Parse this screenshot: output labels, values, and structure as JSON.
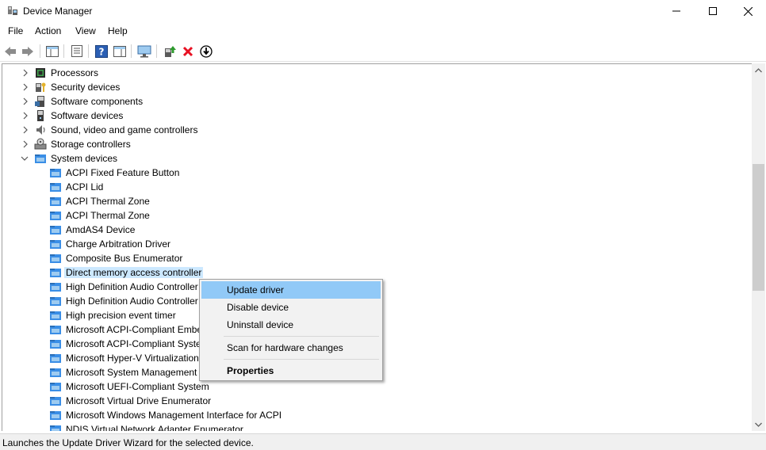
{
  "window": {
    "title": "Device Manager",
    "icon": "device-manager-icon"
  },
  "menu": [
    "File",
    "Action",
    "View",
    "Help"
  ],
  "toolbar": {
    "buttons": [
      "back-arrow-icon",
      "forward-arrow-icon",
      "show-hide-console-tree-icon",
      "properties-icon",
      "help-icon",
      "action-pane-icon",
      "monitor-icon",
      "update-driver-icon",
      "uninstall-icon",
      "download-icon"
    ]
  },
  "tree": {
    "categories": [
      {
        "label": "Processors",
        "icon": "processor-icon",
        "expanded": false
      },
      {
        "label": "Security devices",
        "icon": "security-icon",
        "expanded": false
      },
      {
        "label": "Software components",
        "icon": "software-component-icon",
        "expanded": false
      },
      {
        "label": "Software devices",
        "icon": "software-device-icon",
        "expanded": false
      },
      {
        "label": "Sound, video and game controllers",
        "icon": "speaker-icon",
        "expanded": false
      },
      {
        "label": "Storage controllers",
        "icon": "storage-icon",
        "expanded": false
      },
      {
        "label": "System devices",
        "icon": "system-folder-icon",
        "expanded": true
      }
    ],
    "system_devices": [
      "ACPI Fixed Feature Button",
      "ACPI Lid",
      "ACPI Thermal Zone",
      "ACPI Thermal Zone",
      "AmdAS4 Device",
      "Charge Arbitration Driver",
      "Composite Bus Enumerator",
      "Direct memory access controller",
      "High Definition Audio Controller",
      "High Definition Audio Controller",
      "High precision event timer",
      "Microsoft ACPI-Compliant Embedded Controller",
      "Microsoft ACPI-Compliant System",
      "Microsoft Hyper-V Virtualization Infrastructure Driver",
      "Microsoft System Management BIOS Driver",
      "Microsoft UEFI-Compliant System",
      "Microsoft Virtual Drive Enumerator",
      "Microsoft Windows Management Interface for ACPI",
      "NDIS Virtual Network Adapter Enumerator"
    ],
    "selected_index": 7
  },
  "context_menu": {
    "items": [
      {
        "label": "Update driver",
        "highlighted": true
      },
      {
        "label": "Disable device"
      },
      {
        "label": "Uninstall device"
      },
      {
        "label": "Scan for hardware changes"
      },
      {
        "label": "Properties",
        "bold": true
      }
    ]
  },
  "status": {
    "text": "Launches the Update Driver Wizard for the selected device."
  },
  "colors": {
    "selection": "#cce8ff",
    "menu_highlight": "#91c9f7",
    "close_red": "#e81123"
  }
}
